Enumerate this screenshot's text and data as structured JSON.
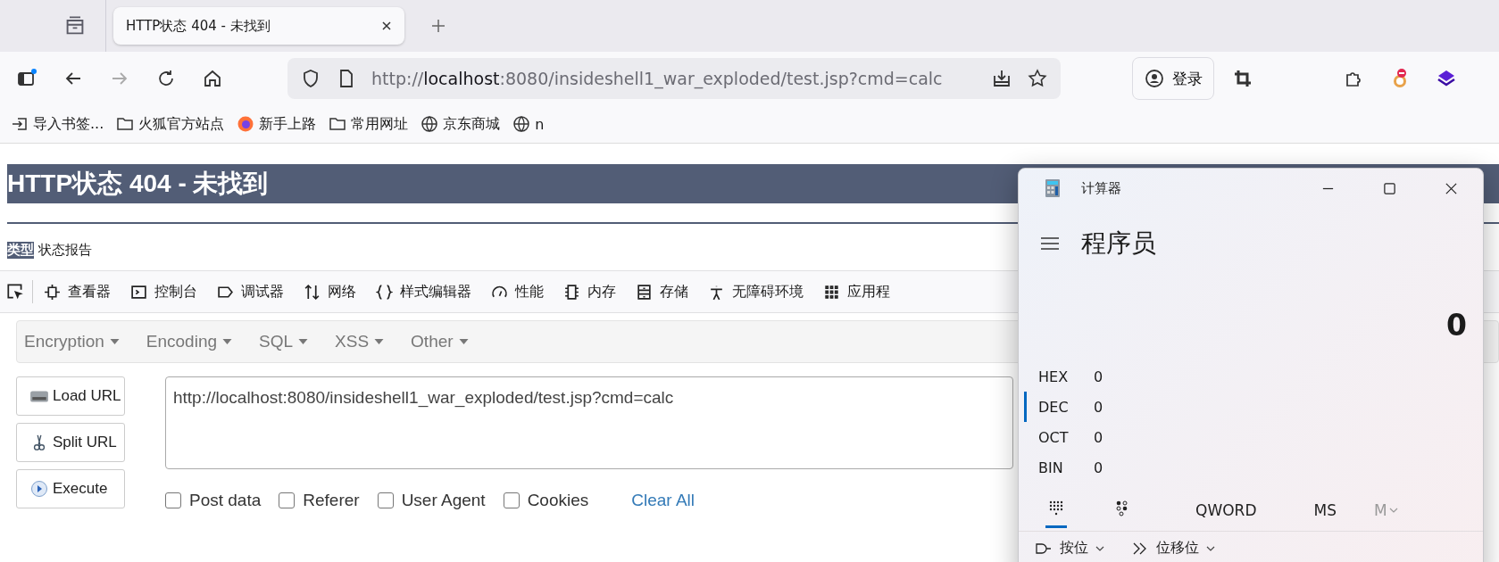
{
  "browser": {
    "tabs": [
      {
        "title": "HTTP状态 404 - 未找到",
        "selected": true
      }
    ],
    "address": "http://**localhost**:8080/insideshell1_war_exploded/test.jsp?cmd=calc",
    "account_button": "登录",
    "bookmarks": [
      {
        "label": "导入书签...",
        "kind": "import"
      },
      {
        "label": "火狐官方站点",
        "kind": "folder"
      },
      {
        "label": "新手上路",
        "kind": "firefox"
      },
      {
        "label": "常用网址",
        "kind": "folder"
      },
      {
        "label": "京东商城",
        "kind": "globe"
      },
      {
        "label": "n",
        "kind": "globe"
      }
    ]
  },
  "page": {
    "heading": "HTTP状态 404 - 未找到",
    "type_label": "类型",
    "type_value": "状态报告"
  },
  "devtools": {
    "tools": [
      {
        "label": "查看器",
        "kind": "inspector"
      },
      {
        "label": "控制台",
        "kind": "console"
      },
      {
        "label": "调试器",
        "kind": "debugger"
      },
      {
        "label": "网络",
        "kind": "network"
      },
      {
        "label": "样式编辑器",
        "kind": "style"
      },
      {
        "label": "性能",
        "kind": "performance"
      },
      {
        "label": "内存",
        "kind": "memory"
      },
      {
        "label": "存储",
        "kind": "storage"
      },
      {
        "label": "无障碍环境",
        "kind": "accessibility"
      },
      {
        "label": "应用程",
        "kind": "application"
      }
    ]
  },
  "hackbar": {
    "menus": [
      "Encryption",
      "Encoding",
      "SQL",
      "XSS",
      "Other"
    ],
    "buttons": [
      {
        "label": "Load URL",
        "kind": "load"
      },
      {
        "label": "Split URL",
        "kind": "split"
      },
      {
        "label": "Execute",
        "kind": "execute"
      }
    ],
    "url": "http://localhost:8080/insideshell1_war_exploded/test.jsp?cmd=calc",
    "options": [
      {
        "label": "Post data",
        "checked": false
      },
      {
        "label": "Referer",
        "checked": false
      },
      {
        "label": "User Agent",
        "checked": false
      },
      {
        "label": "Cookies",
        "checked": false
      }
    ],
    "clear": "Clear All"
  },
  "calculator": {
    "title": "计算器",
    "mode": "程序员",
    "display": "0",
    "bases": [
      {
        "label": "HEX",
        "value": "0",
        "selected": false
      },
      {
        "label": "DEC",
        "value": "0",
        "selected": true
      },
      {
        "label": "OCT",
        "value": "0",
        "selected": false
      },
      {
        "label": "BIN",
        "value": "0",
        "selected": false
      }
    ],
    "keypad_tabs": [
      {
        "kind": "keypad",
        "selected": true
      },
      {
        "kind": "bits",
        "selected": false
      }
    ],
    "word_size": "QWORD",
    "memory_store": "MS",
    "memory_menu": "M",
    "bit_menus": [
      {
        "label": "按位",
        "kind": "bitwise"
      },
      {
        "label": "位移位",
        "kind": "shift"
      }
    ]
  }
}
